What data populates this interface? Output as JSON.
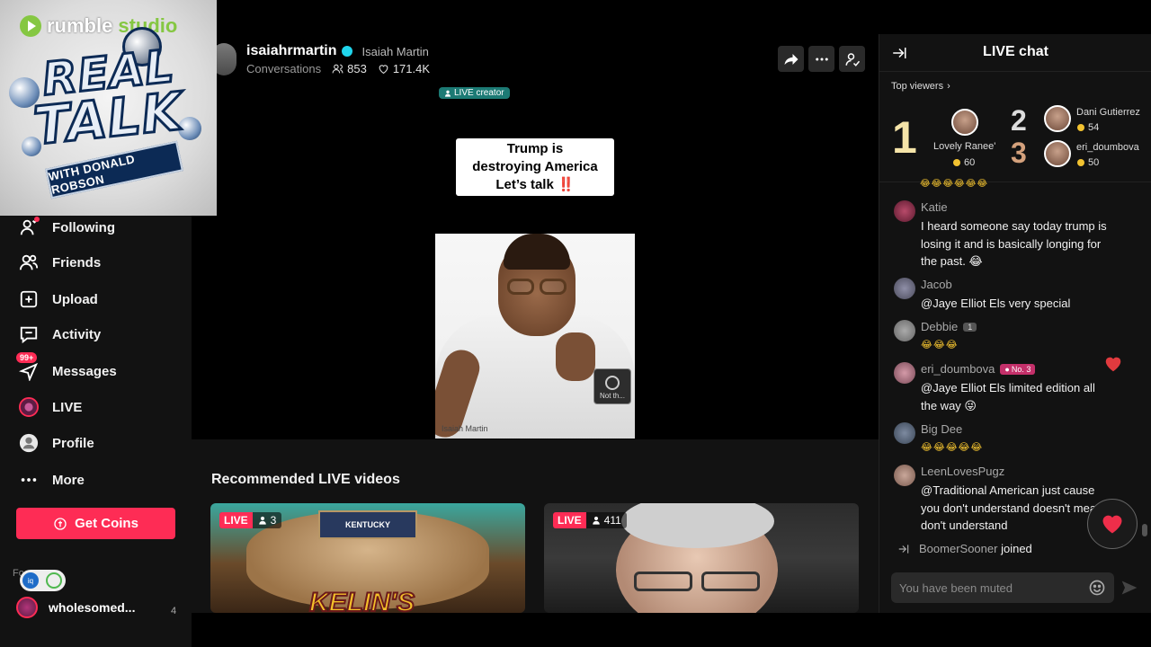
{
  "overlay": {
    "brand": "rumble",
    "brand_suffix": "studio",
    "title_line1": "REAL",
    "title_line2": "TALK",
    "banner": "WITH DONALD ROBSON"
  },
  "sidebar": {
    "items": [
      {
        "label": "Following",
        "icon": "following-icon"
      },
      {
        "label": "Friends",
        "icon": "friends-icon"
      },
      {
        "label": "Upload",
        "icon": "upload-icon"
      },
      {
        "label": "Activity",
        "icon": "activity-icon"
      },
      {
        "label": "Messages",
        "icon": "messages-icon",
        "badge": "99+"
      },
      {
        "label": "LIVE",
        "icon": "live-icon"
      },
      {
        "label": "Profile",
        "icon": "profile-icon"
      },
      {
        "label": "More",
        "icon": "more-icon"
      }
    ],
    "get_coins": "Get Coins",
    "followed_label": "Fo",
    "followed_user": "wholesomed...",
    "followed_count": "4"
  },
  "creator": {
    "handle": "isaiahrmartin",
    "name": "Isaiah Martin",
    "category": "Conversations",
    "viewers": "853",
    "likes": "171.4K"
  },
  "stream": {
    "live_creator": "LIVE creator",
    "overlay_line1": "Trump is",
    "overlay_line2": "destroying America",
    "overlay_line3": "Let’s talk",
    "overlay_emphasis": "‼️",
    "caption": "Isaiah Martin",
    "mini_label": "Not th..."
  },
  "recommended": {
    "title": "Recommended LIVE videos",
    "cards": [
      {
        "tag": "LIVE",
        "count": "3",
        "band": "KENTUCKY",
        "art_text": "KELIN'S"
      },
      {
        "tag": "LIVE",
        "count": "411"
      }
    ]
  },
  "chat": {
    "title": "LIVE chat",
    "top_viewers_label": "Top viewers",
    "top_viewers": [
      {
        "rank": "1",
        "name": "Lovely Ranee'",
        "coins": "60"
      },
      {
        "rank": "2",
        "name": "Dani Gutierrez",
        "coins": "54"
      },
      {
        "rank": "3",
        "name": "eri_doumbova",
        "coins": "50"
      }
    ],
    "partial_emojis": "😂😂😂😂😂😂",
    "messages": [
      {
        "user": "Katie",
        "text": "I heard someone say today trump is losing it and is basically longing for the past. 😂"
      },
      {
        "user": "Jacob",
        "text": "@Jaye Elliot Els very special"
      },
      {
        "user": "Debbie",
        "badge": "1",
        "text": "😂😂😂"
      },
      {
        "user": "eri_doumbova",
        "badge": "No. 3",
        "text": "@Jaye Elliot Els limited edition all the way 😜"
      },
      {
        "user": "Big Dee",
        "text": "😂😂😂😂😂"
      },
      {
        "user": "LeenLovesPugz",
        "text": "@Traditional American just cause you don't understand doesn't mean I don't understand"
      }
    ],
    "joined_user": "BoomerSooner",
    "joined_word": "joined",
    "input_placeholder": "You have been muted"
  },
  "colors": {
    "accent": "#fe2c55",
    "verified": "#20d5ec",
    "coin": "#f2c230",
    "rumble_green": "#85c742"
  }
}
